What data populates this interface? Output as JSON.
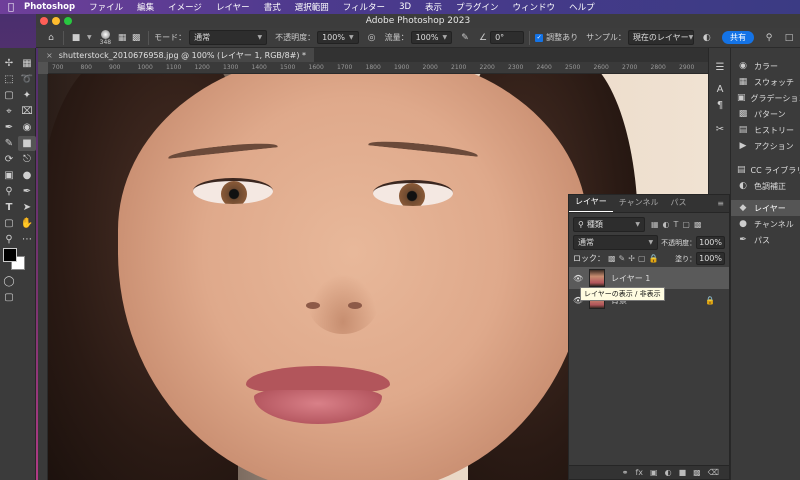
{
  "menubar": {
    "app": "Photoshop",
    "items": [
      "ファイル",
      "編集",
      "イメージ",
      "レイヤー",
      "書式",
      "選択範囲",
      "フィルター",
      "3D",
      "表示",
      "プラグイン",
      "ウィンドウ",
      "ヘルプ"
    ]
  },
  "window": {
    "title": "Adobe Photoshop 2023"
  },
  "options": {
    "brush_size": "348",
    "mode_label": "モード：",
    "mode_value": "通常",
    "opacity_label": "不透明度：",
    "opacity_value": "100%",
    "flow_label": "流量：",
    "flow_value": "100%",
    "angle_value": "0°",
    "align_label": "調整あり",
    "sample_label": "サンプル：",
    "sample_value": "現在のレイヤー",
    "share_label": "共有"
  },
  "document": {
    "tab_title": "shutterstock_2010676958.jpg @ 100% (レイヤー 1, RGB/8#) *"
  },
  "ruler": {
    "ticks": [
      "700",
      "800",
      "900",
      "1000",
      "1100",
      "1200",
      "1300",
      "1400",
      "1500",
      "1600",
      "1700",
      "1800",
      "1900",
      "2000",
      "2100",
      "2200",
      "2300",
      "2400",
      "2500",
      "2600",
      "2700",
      "2800",
      "2900"
    ]
  },
  "right_panel": {
    "items": [
      "カラー",
      "スウォッチ",
      "グラデーション",
      "パターン",
      "ヒストリー",
      "アクション",
      "CC ライブラリ",
      "色調補正",
      "レイヤー",
      "チャンネル",
      "パス"
    ]
  },
  "layers_panel": {
    "tabs": [
      "レイヤー",
      "チャンネル",
      "パス"
    ],
    "filter_value": "種類",
    "blend_value": "通常",
    "opacity_label": "不透明度：",
    "opacity_value": "100%",
    "lock_label": "ロック：",
    "fill_label": "塗り：",
    "fill_value": "100%",
    "layers": [
      {
        "name": "レイヤー 1"
      },
      {
        "name": "背景"
      }
    ],
    "tooltip": "レイヤーの表示 / 非表示"
  }
}
